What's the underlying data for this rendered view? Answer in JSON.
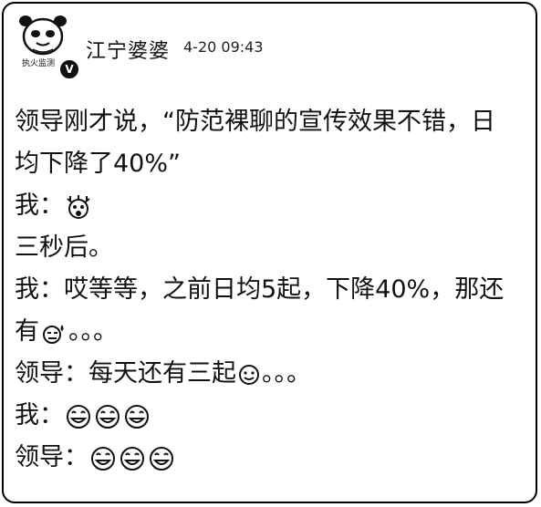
{
  "post": {
    "username": "江宁婆婆",
    "timestamp": "4-20 09:43",
    "avatar_caption": "执火监测",
    "verified_mark": "V"
  },
  "lines": {
    "l1": "领导刚才说，“防范裸聊的宣传效果不错，日",
    "l2": "均下降了40%”",
    "l3_speaker": "我：",
    "l4": "三秒后。",
    "l5": "我：哎等等，之前日均5起，下降40%，那还",
    "l6_a": "有",
    "l6_b": "。。。",
    "l7_a": "领导：每天还有三起",
    "l7_b": "。。。",
    "l8_speaker": "我：",
    "l9_speaker": "领导："
  },
  "emojis": {
    "l3": "shocked-face-icon",
    "l6": "sweat-face-icon",
    "l7": "smile-face-icon",
    "l8": "smile-face-icon x3",
    "l9": "smile-face-icon x3"
  },
  "colors": {
    "text": "#111111",
    "border": "#000000",
    "background": "#ffffff"
  }
}
